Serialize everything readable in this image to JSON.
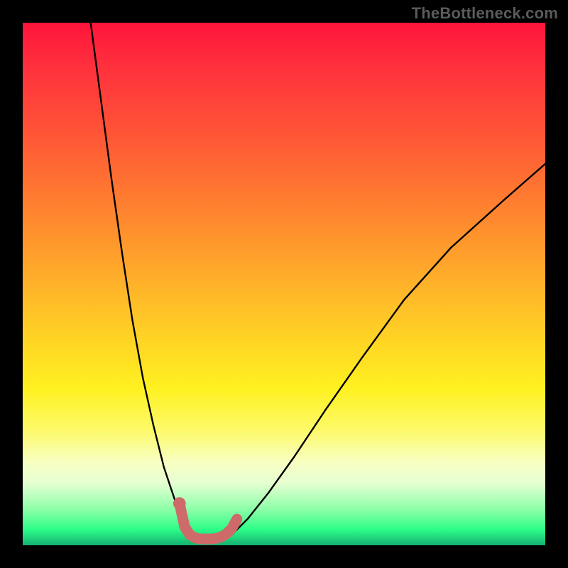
{
  "watermark": "TheBottleneck.com",
  "chart_data": {
    "type": "line",
    "title": "",
    "xlabel": "",
    "ylabel": "",
    "xlim": [
      0,
      100
    ],
    "ylim": [
      0,
      100
    ],
    "grid": false,
    "legend": false,
    "annotations": [],
    "series": [
      {
        "name": "left-curve",
        "color": "#000000",
        "x": [
          13,
          15,
          17,
          19,
          21,
          23,
          25,
          27,
          29,
          31,
          32
        ],
        "y": [
          100,
          85,
          70,
          56,
          43,
          32,
          23,
          15,
          9,
          4,
          2
        ]
      },
      {
        "name": "right-curve",
        "color": "#000000",
        "x": [
          40,
          43,
          47,
          52,
          58,
          65,
          73,
          82,
          92,
          100
        ],
        "y": [
          2,
          5,
          10,
          17,
          26,
          36,
          47,
          57,
          66,
          73
        ]
      },
      {
        "name": "bottom-pink-segment",
        "color": "#cf6a6a",
        "x": [
          30,
          31,
          32,
          33,
          34,
          35,
          36,
          37,
          38,
          39,
          40,
          41
        ],
        "y": [
          8,
          3.5,
          2,
          1.4,
          1.2,
          1.2,
          1.2,
          1.3,
          1.6,
          2.2,
          3.2,
          5
        ]
      }
    ],
    "markers": [
      {
        "name": "pink-dot-left",
        "x": 30,
        "y": 8,
        "r": 1.2,
        "color": "#cf6a6a"
      }
    ],
    "background_gradient_stops": [
      {
        "pos": 0,
        "color": "#ff143b"
      },
      {
        "pos": 22,
        "color": "#ff5736"
      },
      {
        "pos": 55,
        "color": "#ffc227"
      },
      {
        "pos": 78,
        "color": "#fdfa6a"
      },
      {
        "pos": 93,
        "color": "#8fffa9"
      },
      {
        "pos": 100,
        "color": "#14b171"
      }
    ]
  }
}
